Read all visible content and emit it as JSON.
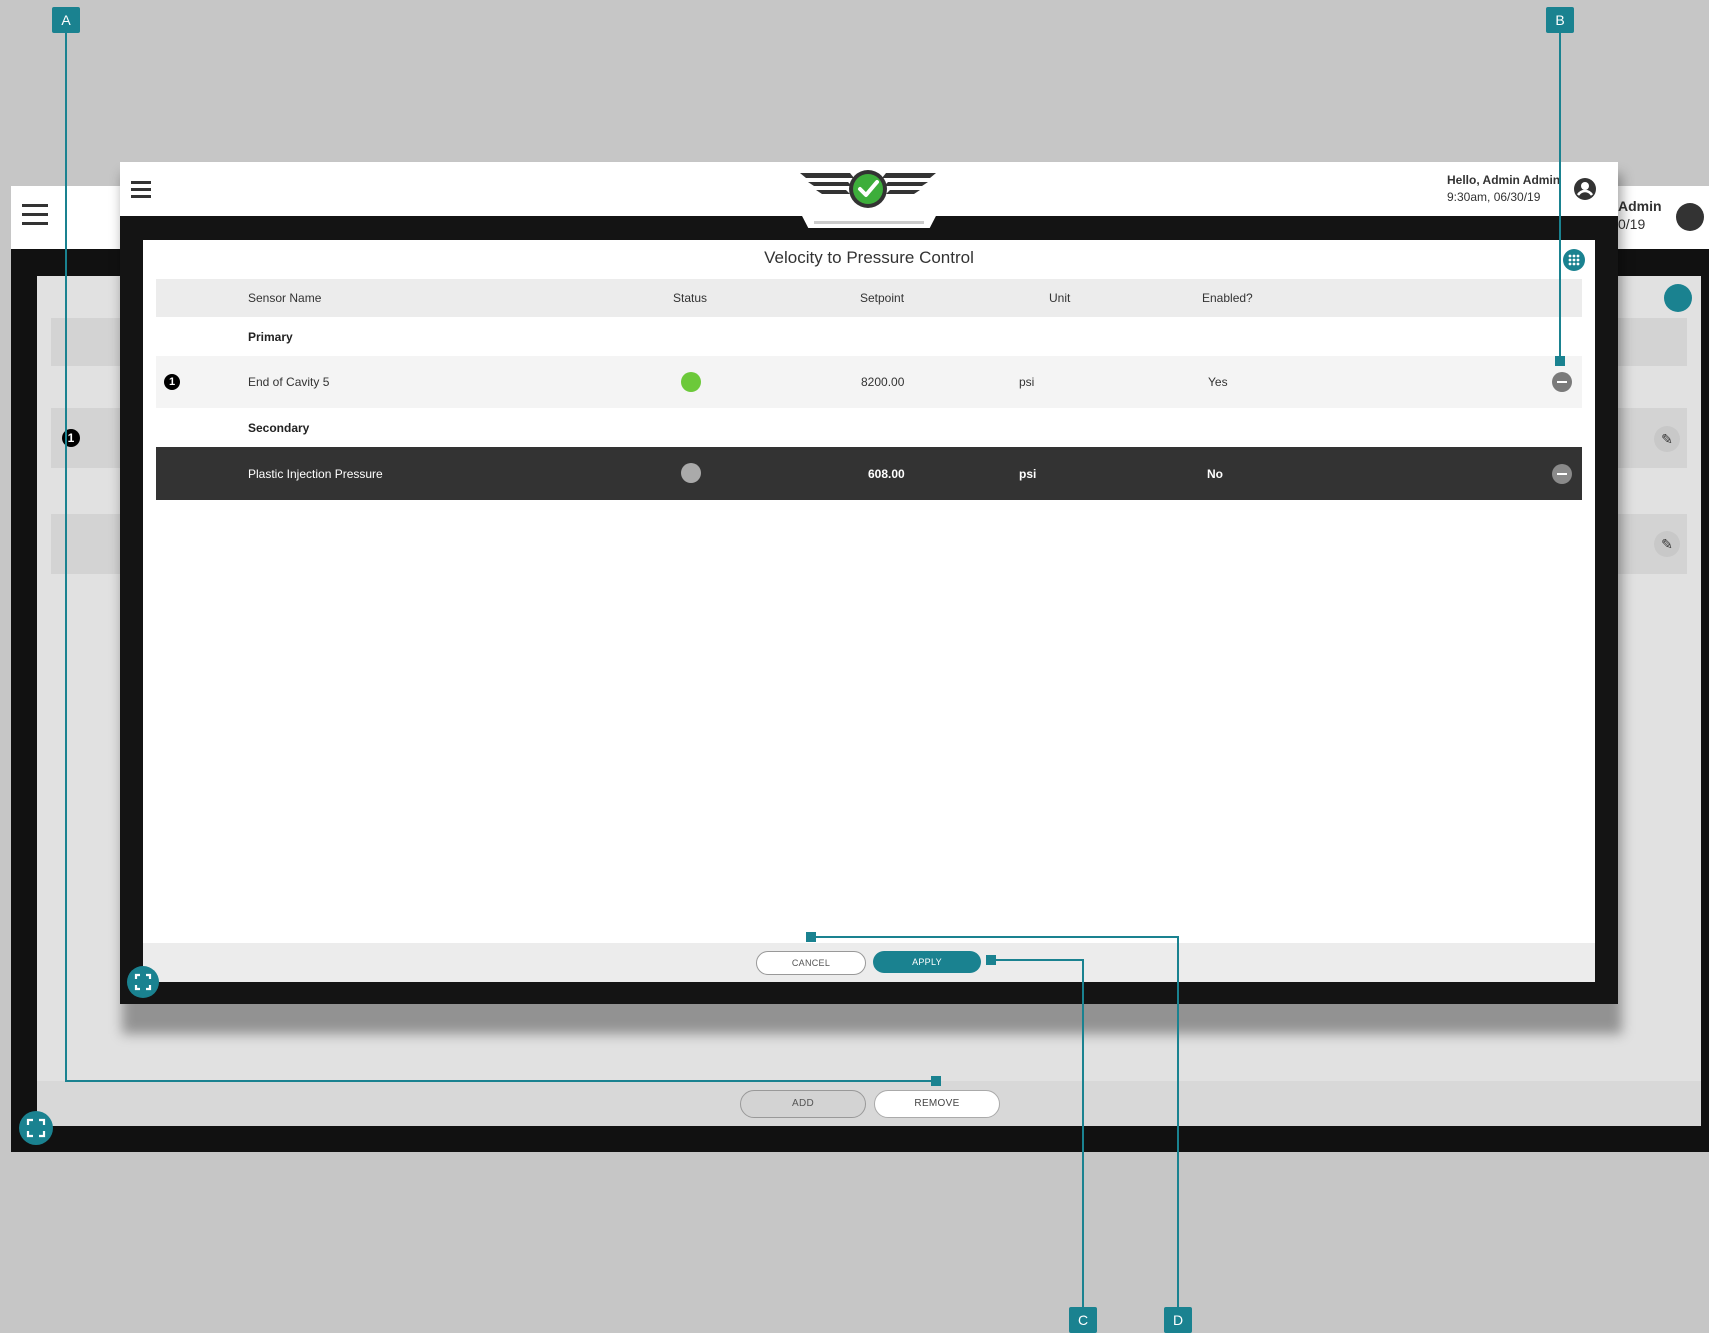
{
  "background_app": {
    "user_greeting_partial": "Admin",
    "user_time_partial": "0/19",
    "row_number": "1",
    "buttons": {
      "add_label": "ADD",
      "remove_label": "REMOVE"
    }
  },
  "header": {
    "greeting": "Hello, Admin Admin",
    "datetime": "9:30am, 06/30/19"
  },
  "dialog": {
    "title": "Velocity to Pressure Control",
    "columns": {
      "sensor_name": "Sensor Name",
      "status": "Status",
      "setpoint": "Setpoint",
      "unit": "Unit",
      "enabled": "Enabled?"
    },
    "groups": {
      "primary_label": "Primary",
      "secondary_label": "Secondary"
    },
    "rows": [
      {
        "number": "1",
        "sensor_name": "End of Cavity 5",
        "status_color": "#6cc93a",
        "setpoint": "8200.00",
        "unit": "psi",
        "enabled": "Yes"
      },
      {
        "number": "",
        "sensor_name": "Plastic Injection Pressure",
        "status_color": "#aaaaaa",
        "setpoint": "608.00",
        "unit": "psi",
        "enabled": "No"
      }
    ],
    "footer": {
      "cancel_label": "CANCEL",
      "apply_label": "APPLY"
    }
  },
  "callouts": {
    "a": "A",
    "b": "B",
    "c": "C",
    "d": "D"
  },
  "colors": {
    "accent": "#1a8290",
    "status_ok": "#6cc93a",
    "status_off": "#aaaaaa",
    "selected_row": "#333333"
  }
}
